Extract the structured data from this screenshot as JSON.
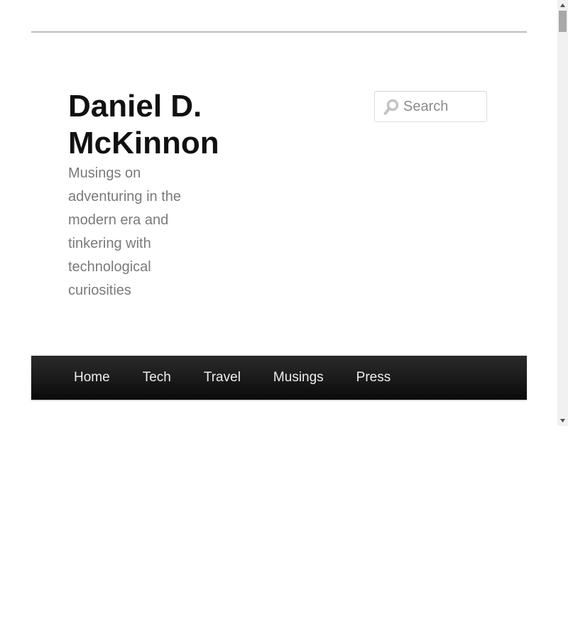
{
  "header": {
    "site_title_line1": "Daniel D.",
    "site_title_line2": "McKinnon",
    "tagline": "Musings on adventuring in the modern era and tinkering with technological curiosities"
  },
  "search": {
    "placeholder": "Search",
    "value": ""
  },
  "nav": {
    "items": [
      {
        "label": "Home"
      },
      {
        "label": "Tech"
      },
      {
        "label": "Travel"
      },
      {
        "label": "Musings"
      },
      {
        "label": "Press"
      }
    ]
  },
  "colors": {
    "title": "#111111",
    "tagline": "#7a7a7a",
    "nav_bg": "#1a1a1a",
    "nav_text": "#eeeeee",
    "rule": "#bdbdbd"
  }
}
